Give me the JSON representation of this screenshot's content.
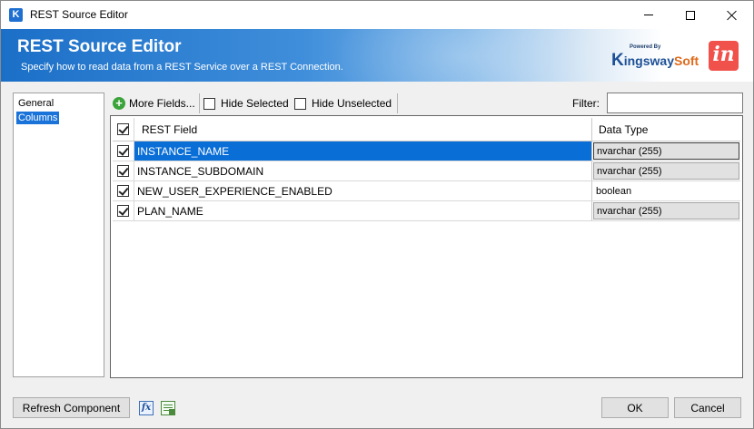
{
  "window": {
    "title": "REST Source Editor",
    "app_icon_letter": "K"
  },
  "banner": {
    "title": "REST Source Editor",
    "subtitle": "Specify how to read data from a REST Service over a REST Connection.",
    "logo_powered": "Powered By",
    "logo_k": "K",
    "logo_ingsway": "ingsway",
    "logo_soft": "Soft",
    "app_logo_text": "in"
  },
  "nav": {
    "items": [
      "General",
      "Columns"
    ],
    "selected": "Columns"
  },
  "toolbar": {
    "more_fields": "More Fields...",
    "hide_selected": "Hide Selected",
    "hide_unselected": "Hide Unselected",
    "filter_label": "Filter:",
    "filter_value": ""
  },
  "grid": {
    "headers": {
      "field": "REST Field",
      "type": "Data Type"
    },
    "rows": [
      {
        "field": "INSTANCE_NAME",
        "type": "nvarchar (255)",
        "checked": true
      },
      {
        "field": "INSTANCE_SUBDOMAIN",
        "type": "nvarchar (255)",
        "checked": true
      },
      {
        "field": "NEW_USER_EXPERIENCE_ENABLED",
        "type": "boolean",
        "checked": true
      },
      {
        "field": "PLAN_NAME",
        "type": "nvarchar (255)",
        "checked": true
      }
    ]
  },
  "footer": {
    "refresh": "Refresh Component",
    "fx": "fx",
    "ok": "OK",
    "cancel": "Cancel"
  },
  "colors": {
    "selection": "#0a6ed7",
    "nav_selection": "#1a73d9",
    "banner_start": "#1b6fc7"
  }
}
